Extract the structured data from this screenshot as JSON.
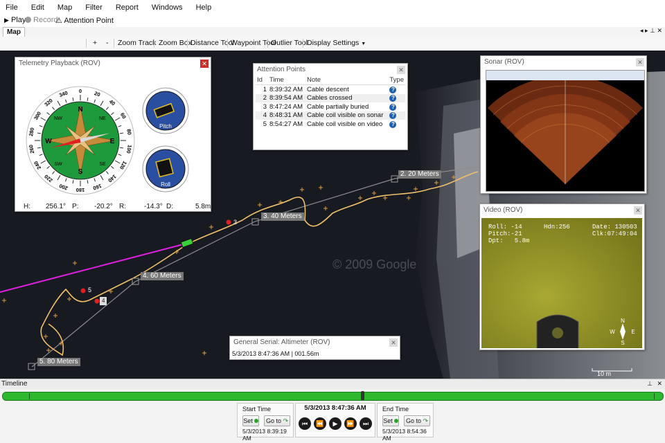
{
  "menu": [
    "File",
    "Edit",
    "Map",
    "Filter",
    "Report",
    "Windows",
    "Help"
  ],
  "toolbar": {
    "play": "Play",
    "record": "Record",
    "attention": "Attention Point"
  },
  "tabs": {
    "map": "Map"
  },
  "map_tools": [
    "+",
    "-",
    "Zoom Track",
    "Zoom Box",
    "Distance Tool",
    "Waypoint Tool",
    "Outlier Tool",
    "Display Settings"
  ],
  "map": {
    "distance_labels": [
      "2. 20 Meters",
      "3. 40 Meters",
      "4. 60 Meters",
      "5. 80 Meters"
    ],
    "markers": [
      "3",
      "4",
      "5"
    ],
    "scale": "10 m",
    "watermark": "© 2009 Google"
  },
  "telemetry": {
    "title": "Telemetry Playback (ROV)",
    "heading_deg": 256.1,
    "pitch_deg": -20.2,
    "roll_deg": -14.3,
    "compass_ticks": [
      "340",
      "320",
      "300",
      "280",
      "260",
      "240",
      "220",
      "200",
      "180",
      "160",
      "140",
      "120",
      "100",
      "80",
      "60",
      "40",
      "20",
      "0"
    ],
    "cardinals": [
      "N",
      "NE",
      "E",
      "SE",
      "S",
      "SW",
      "W",
      "NW"
    ],
    "pitch_label": "Pitch",
    "roll_label": "Roll",
    "readout": {
      "h_label": "H:",
      "h": "256.1°",
      "p_label": "P:",
      "p": "-20.2°",
      "r_label": "R:",
      "r": "-14.3°",
      "d_label": "D:",
      "d": "5.8m"
    }
  },
  "attention": {
    "title": "Attention Points",
    "columns": [
      "Id",
      "Time",
      "Note",
      "Type"
    ],
    "rows": [
      {
        "id": "1",
        "time": "8:39:32 AM",
        "note": "Cable descent"
      },
      {
        "id": "2",
        "time": "8:39:54 AM",
        "note": "Cables crossed"
      },
      {
        "id": "3",
        "time": "8:47:24 AM",
        "note": "Cable partially buried"
      },
      {
        "id": "4",
        "time": "8:48:31 AM",
        "note": "Cable coil visible on sonar"
      },
      {
        "id": "5",
        "time": "8:54:27 AM",
        "note": "Cable coil visible on video"
      }
    ]
  },
  "sonar": {
    "title": "Sonar (ROV)"
  },
  "video": {
    "title": "Video (ROV)",
    "osd": {
      "roll": "Roll: -14",
      "hdn": "Hdn:256",
      "date": "Date: 130503",
      "pitch": "Pitch:-21",
      "clk": "Clk:07:49:04",
      "dpt": "Dpt:   5.8m"
    },
    "compass": [
      "N",
      "W",
      "E",
      "S"
    ]
  },
  "serial": {
    "title": "General Serial: Altimeter (ROV)",
    "value": "5/3/2013 8:47:36 AM | 001.56m"
  },
  "timeline": {
    "title": "Timeline",
    "progress": 0.545,
    "start_label": "Start Time",
    "end_label": "End Time",
    "current": "5/3/2013 8:47:36 AM",
    "start_time": "5/3/2013 8:39:19 AM",
    "end_time": "5/3/2013 8:54:36 AM",
    "set": "Set",
    "goto": "Go to"
  }
}
